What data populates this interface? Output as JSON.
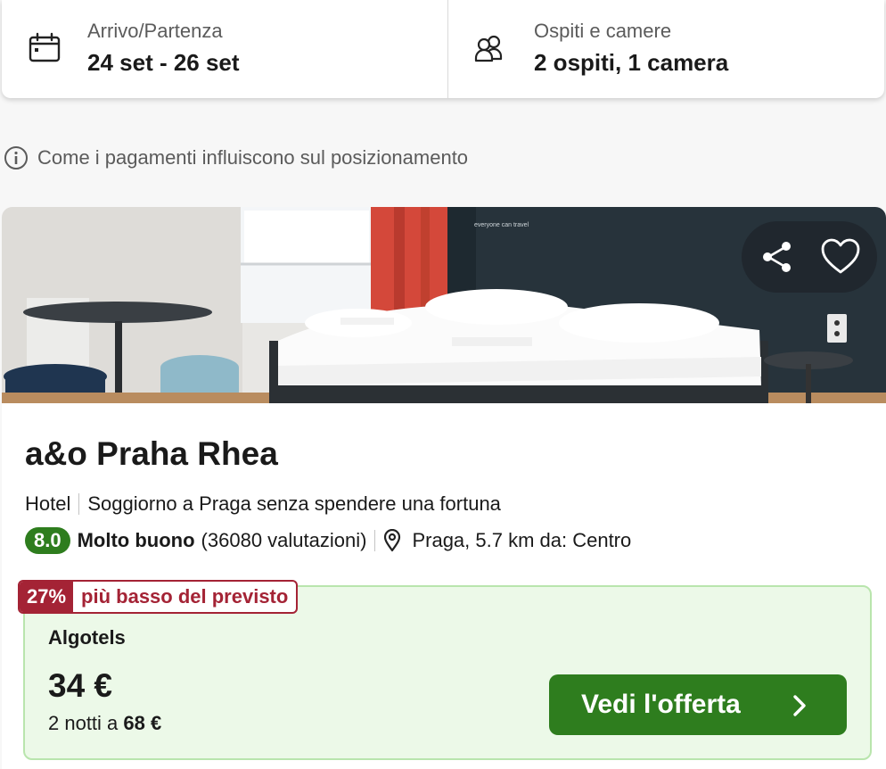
{
  "search": {
    "dates": {
      "label": "Arrivo/Partenza",
      "value": "24 set - 26 set",
      "icon": "calendar-icon"
    },
    "guests": {
      "label": "Ospiti e camere",
      "value": "2 ospiti, 1 camera",
      "icon": "users-icon"
    }
  },
  "ranking_info": {
    "text": "Come i pagamenti influiscono sul posizionamento",
    "icon": "info-icon"
  },
  "hotel": {
    "name": "a&o Praha Rhea",
    "type": "Hotel",
    "tagline": "Soggiorno a Praga senza spendere una fortuna",
    "rating_score": "8.0",
    "rating_label": "Molto buono",
    "rating_count": "(36080 valutazioni)",
    "location": "Praga, 5.7 km da: Centro",
    "photo_caption": "everyone can travel",
    "actions": {
      "share_icon": "share-icon",
      "favorite_icon": "heart-icon"
    }
  },
  "deal": {
    "badge_percent": "27%",
    "badge_text": "più basso del previsto",
    "provider": "Algotels",
    "price": "34 €",
    "total_prefix": "2 notti a",
    "total_price": "68 €",
    "cta_label": "Vedi l'offerta"
  },
  "colors": {
    "score_green": "#2e7d1e",
    "cta_green": "#2e7d1e",
    "badge_red": "#a42335",
    "deal_bg": "#ecf9e8",
    "deal_border": "#b9e5ad"
  }
}
